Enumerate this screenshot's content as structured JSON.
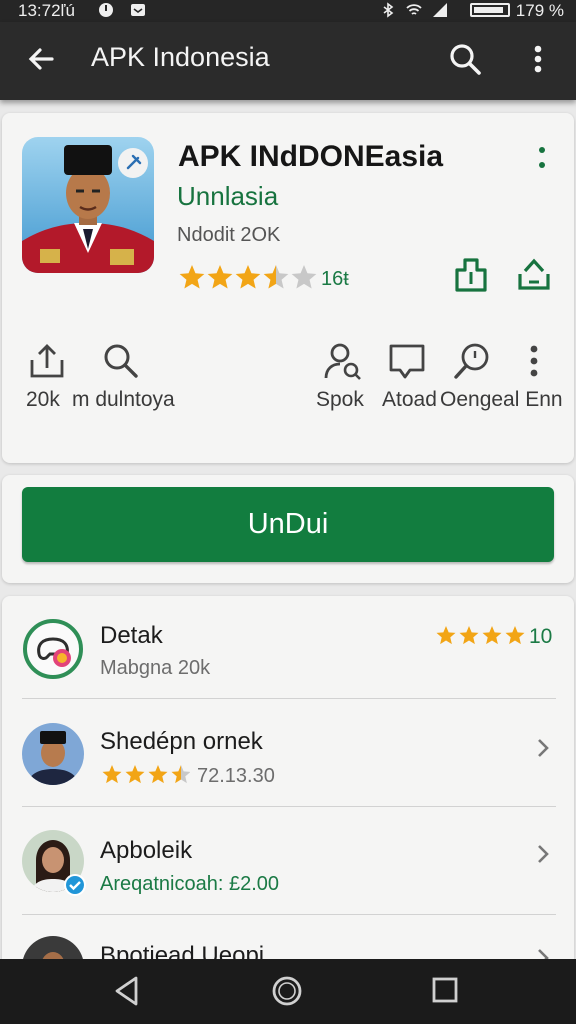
{
  "status_bar": {
    "time": "13:72ľú",
    "battery_pct": "179 %",
    "battery_level": 0.9
  },
  "app_bar": {
    "title": "APK Indonesia",
    "icons": [
      "back-arrow-icon",
      "search-icon",
      "more-vert-icon"
    ]
  },
  "app": {
    "name": "APK INdDONEasia",
    "developer": "Unnlasia",
    "meta": "Ndodit 2OK",
    "rating": 3.5,
    "rating_count": "16ŧ"
  },
  "actions": [
    {
      "icon": "share-up-icon"
    },
    {
      "icon": "search-icon"
    },
    {
      "icon": "person-search-icon"
    },
    {
      "icon": "chat-bubble-icon"
    },
    {
      "icon": "magnifier-icon"
    },
    {
      "icon": "more-vert-icon"
    }
  ],
  "action_labels": {
    "left_a": "20k",
    "left_b": "m dulntoya",
    "right_a": "Spok",
    "right_b": "Atoad",
    "right_c": "Oengeal Enn"
  },
  "install": {
    "label": "UnDui"
  },
  "list": [
    {
      "title": "Detak",
      "subtitle": "Mabgna 20k",
      "rating": 4,
      "rating_value": "10",
      "icon": "game-controller-icon"
    },
    {
      "title": "Shedépn ornek",
      "subtitle": "72.13.30",
      "rating": 3.5,
      "icon": "chevron-right-icon"
    },
    {
      "title": "Apboleik",
      "subtitle": "Areqatnicoah: £2.00",
      "icon": "chevron-right-icon"
    },
    {
      "title": "Bpotiead Ueopi",
      "icon": "chevron-right-icon"
    }
  ],
  "colors": {
    "accent_green": "#127d3f",
    "star_gold": "#f2a516",
    "star_empty": "#c8c8c8",
    "app_bar": "#2b2b2b"
  },
  "nav_icons": [
    "back-triangle-icon",
    "home-circle-icon",
    "recents-square-icon"
  ]
}
